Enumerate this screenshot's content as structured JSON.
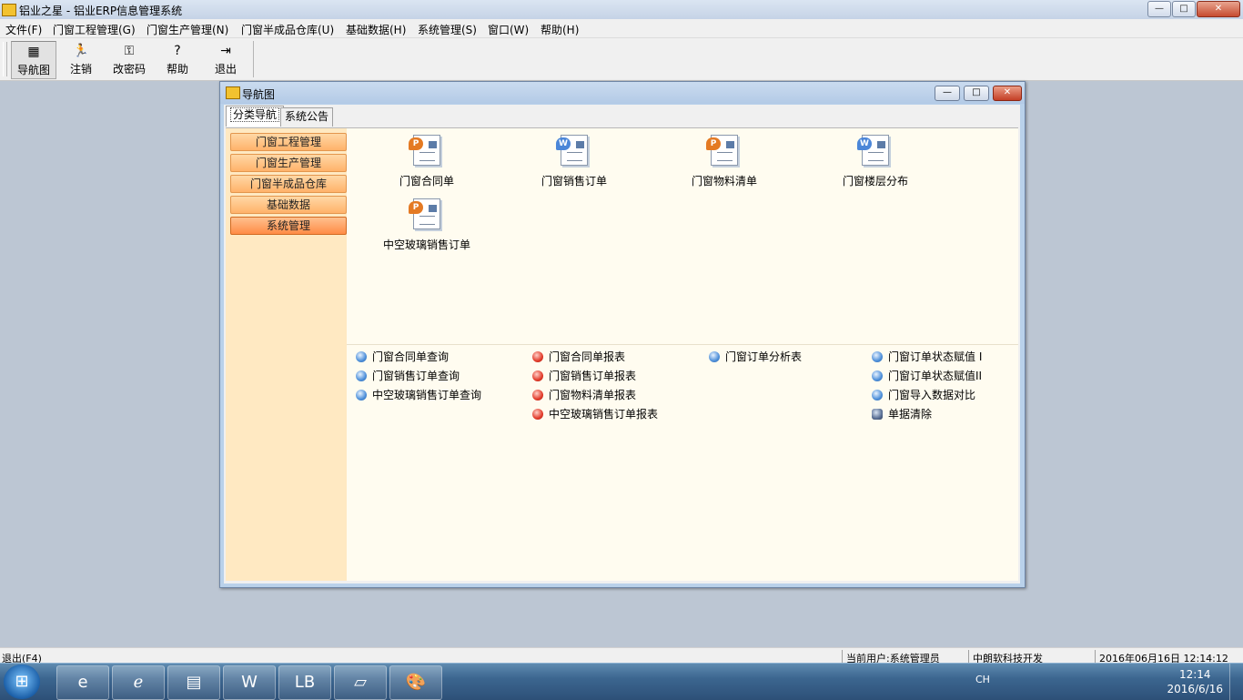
{
  "app": {
    "title": "铝业之星 - 铝业ERP信息管理系统",
    "window_buttons": {
      "minimize": "—",
      "maximize": "□",
      "close": "✕"
    }
  },
  "menu": [
    {
      "label": "文件(F)"
    },
    {
      "label": "门窗工程管理(G)"
    },
    {
      "label": "门窗生产管理(N)"
    },
    {
      "label": "门窗半成品仓库(U)"
    },
    {
      "label": "基础数据(H)"
    },
    {
      "label": "系统管理(S)"
    },
    {
      "label": "窗口(W)"
    },
    {
      "label": "帮助(H)"
    }
  ],
  "toolbar": [
    {
      "label": "导航图",
      "icon": "navigation-map-icon",
      "glyph": "▦"
    },
    {
      "label": "注销",
      "icon": "logout-runner-icon",
      "glyph": "🏃"
    },
    {
      "label": "改密码",
      "icon": "key-icon",
      "glyph": "⚿"
    },
    {
      "label": "帮助",
      "icon": "help-icon",
      "glyph": "?"
    },
    {
      "label": "退出",
      "icon": "exit-door-icon",
      "glyph": "⇥"
    }
  ],
  "child": {
    "title": "导航图",
    "tabs": [
      {
        "label": "分类导航"
      },
      {
        "label": "系统公告"
      }
    ],
    "sidebar": [
      {
        "label": "门窗工程管理"
      },
      {
        "label": "门窗生产管理"
      },
      {
        "label": "门窗半成品仓库"
      },
      {
        "label": "基础数据"
      },
      {
        "label": "系统管理"
      }
    ],
    "icons": [
      {
        "label": "门窗合同单",
        "badge": "P"
      },
      {
        "label": "门窗销售订单",
        "badge": "W"
      },
      {
        "label": "门窗物料清单",
        "badge": "P"
      },
      {
        "label": "门窗楼层分布",
        "badge": "W"
      },
      {
        "label": "中空玻璃销售订单",
        "badge": "P"
      }
    ],
    "links": {
      "col1": [
        {
          "label": "门窗合同单查询"
        },
        {
          "label": "门窗销售订单查询"
        },
        {
          "label": "中空玻璃销售订单查询"
        }
      ],
      "col2": [
        {
          "label": "门窗合同单报表"
        },
        {
          "label": "门窗销售订单报表"
        },
        {
          "label": "门窗物料清单报表"
        },
        {
          "label": "中空玻璃销售订单报表"
        }
      ],
      "col3": [
        {
          "label": "门窗订单分析表"
        }
      ],
      "col4": [
        {
          "label": "门窗订单状态赋值 I"
        },
        {
          "label": "门窗订单状态赋值II"
        },
        {
          "label": "门窗导入数据对比"
        },
        {
          "label": "单据清除"
        }
      ]
    }
  },
  "status": {
    "left": "退出(F4)",
    "user": "当前用户:系统管理员",
    "company": "中朗软科技开发",
    "datetime": "2016年06月16日 12:14:12"
  },
  "taskbar": {
    "start_glyph": "⊞",
    "apps": [
      {
        "name": "ie-icon",
        "glyph": "e"
      },
      {
        "name": "ie-alt-icon",
        "glyph": "ℯ"
      },
      {
        "name": "folder-icon",
        "glyph": "▤"
      },
      {
        "name": "word-icon",
        "glyph": "W"
      },
      {
        "name": "lb-app-icon",
        "glyph": "LB"
      },
      {
        "name": "notepad-icon",
        "glyph": "▱"
      },
      {
        "name": "paint-icon",
        "glyph": "🎨"
      }
    ],
    "tray": "CH",
    "time": "12:14",
    "date": "2016/6/16"
  }
}
